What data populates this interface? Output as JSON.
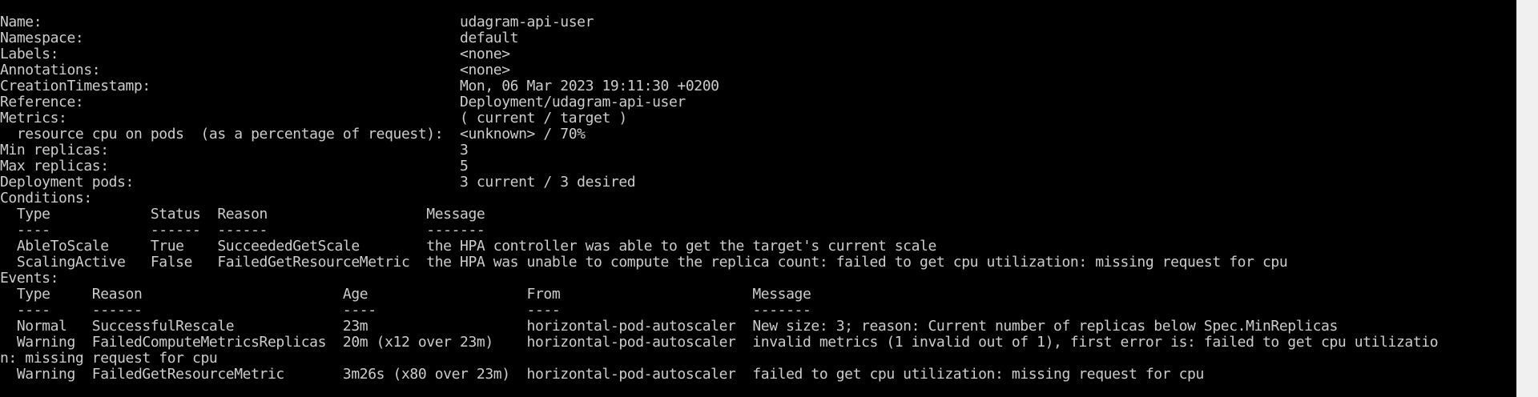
{
  "terminal": {
    "lines": [
      "Name:                                                  udagram-api-user",
      "Namespace:                                             default",
      "Labels:                                                <none>",
      "Annotations:                                           <none>",
      "CreationTimestamp:                                     Mon, 06 Mar 2023 19:11:30 +0200",
      "Reference:                                             Deployment/udagram-api-user",
      "Metrics:                                               ( current / target )",
      "  resource cpu on pods  (as a percentage of request):  <unknown> / 70%",
      "Min replicas:                                          3",
      "Max replicas:                                          5",
      "Deployment pods:                                       3 current / 3 desired",
      "Conditions:",
      "  Type            Status  Reason                   Message",
      "  ----            ------  ------                   -------",
      "  AbleToScale     True    SucceededGetScale        the HPA controller was able to get the target's current scale",
      "  ScalingActive   False   FailedGetResourceMetric  the HPA was unable to compute the replica count: failed to get cpu utilization: missing request for cpu",
      "Events:",
      "  Type     Reason                        Age                   From                       Message",
      "  ----     ------                        ----                  ----                       -------",
      "  Normal   SuccessfulRescale             23m                   horizontal-pod-autoscaler  New size: 3; reason: Current number of replicas below Spec.MinReplicas",
      "  Warning  FailedComputeMetricsReplicas  20m (x12 over 23m)    horizontal-pod-autoscaler  invalid metrics (1 invalid out of 1), first error is: failed to get cpu utilizatio",
      "n: missing request for cpu",
      "  Warning  FailedGetResourceMetric       3m26s (x80 over 23m)  horizontal-pod-autoscaler  failed to get cpu utilization: missing request for cpu"
    ]
  },
  "colors": {
    "background": "#000000",
    "foreground": "#cccccc",
    "gutter": "#f0f0f0"
  }
}
